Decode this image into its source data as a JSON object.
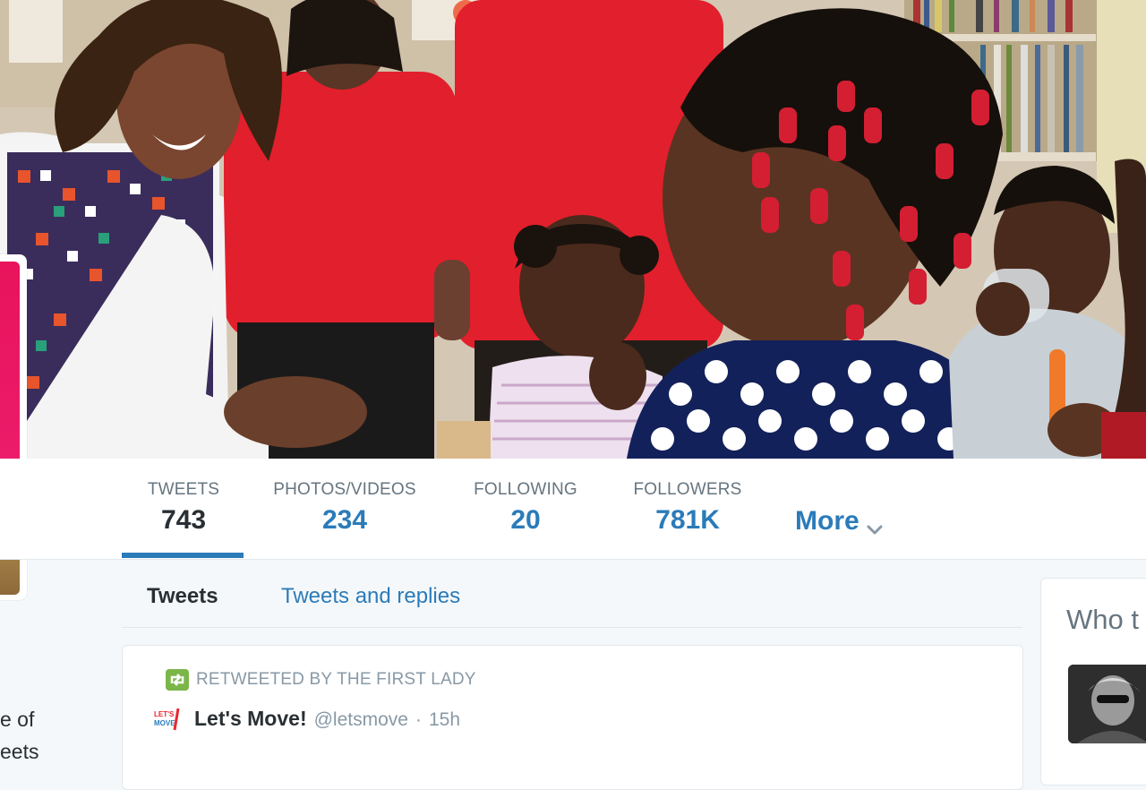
{
  "stats": [
    {
      "label": "TWEETS",
      "value": "743"
    },
    {
      "label": "PHOTOS/VIDEOS",
      "value": "234"
    },
    {
      "label": "FOLLOWING",
      "value": "20"
    },
    {
      "label": "FOLLOWERS",
      "value": "781K"
    }
  ],
  "nav": {
    "more_label": "More"
  },
  "tabs": [
    {
      "label": "Tweets"
    },
    {
      "label": "Tweets and replies"
    }
  ],
  "tweet": {
    "retweet_label": "RETWEETED BY THE FIRST LADY",
    "author_name": "Let's Move!",
    "author_handle": "@letsmove",
    "separator": "·",
    "time": "15h"
  },
  "bio_fragment": {
    "line1": "e of",
    "line2": "eets"
  },
  "who_to_follow": {
    "title": "Who t"
  },
  "colors": {
    "link": "#2b7bb9",
    "text": "#292f33",
    "muted": "#8899a6",
    "retweet": "#7ab648",
    "avatar_pink": "#e8135b"
  },
  "icons": [
    "retweet-icon",
    "chevron-down-icon",
    "letsmove-logo"
  ]
}
